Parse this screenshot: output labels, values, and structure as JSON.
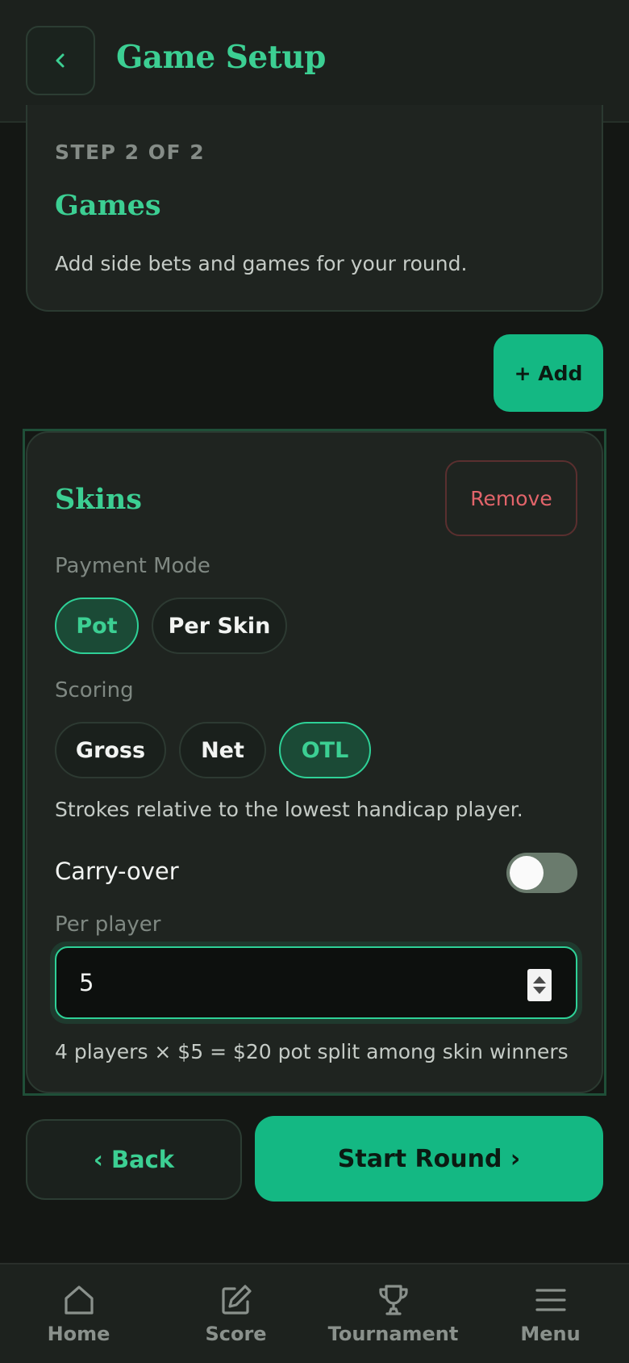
{
  "header": {
    "title": "Game Setup",
    "back_icon": "chevron-left-icon"
  },
  "step": {
    "label": "STEP 2 OF 2",
    "title": "Games",
    "description": "Add side bets and games for your round."
  },
  "add_button": "+ Add",
  "game": {
    "title": "Skins",
    "remove_label": "Remove",
    "payment_mode_label": "Payment Mode",
    "payment_modes": [
      {
        "label": "Pot",
        "selected": true
      },
      {
        "label": "Per Skin",
        "selected": false
      }
    ],
    "scoring_label": "Scoring",
    "scoring_options": [
      {
        "label": "Gross",
        "selected": false
      },
      {
        "label": "Net",
        "selected": false
      },
      {
        "label": "OTL",
        "selected": true
      }
    ],
    "scoring_hint": "Strokes relative to the lowest handicap player.",
    "carry_over_label": "Carry-over",
    "carry_over_on": false,
    "per_player_label": "Per player",
    "per_player_value": "5",
    "summary": "4 players × $5 = $20 pot split among skin winners"
  },
  "footer": {
    "back_label": "‹ Back",
    "start_label": "Start Round ›"
  },
  "tabbar": [
    {
      "label": "Home",
      "icon": "home-icon"
    },
    {
      "label": "Score",
      "icon": "edit-icon"
    },
    {
      "label": "Tournament",
      "icon": "trophy-icon"
    },
    {
      "label": "Menu",
      "icon": "menu-icon"
    }
  ],
  "colors": {
    "accent": "#14b883",
    "accent_text": "#3ccf93",
    "background": "#141714",
    "card": "#1f2420",
    "danger": "#e2646a"
  }
}
